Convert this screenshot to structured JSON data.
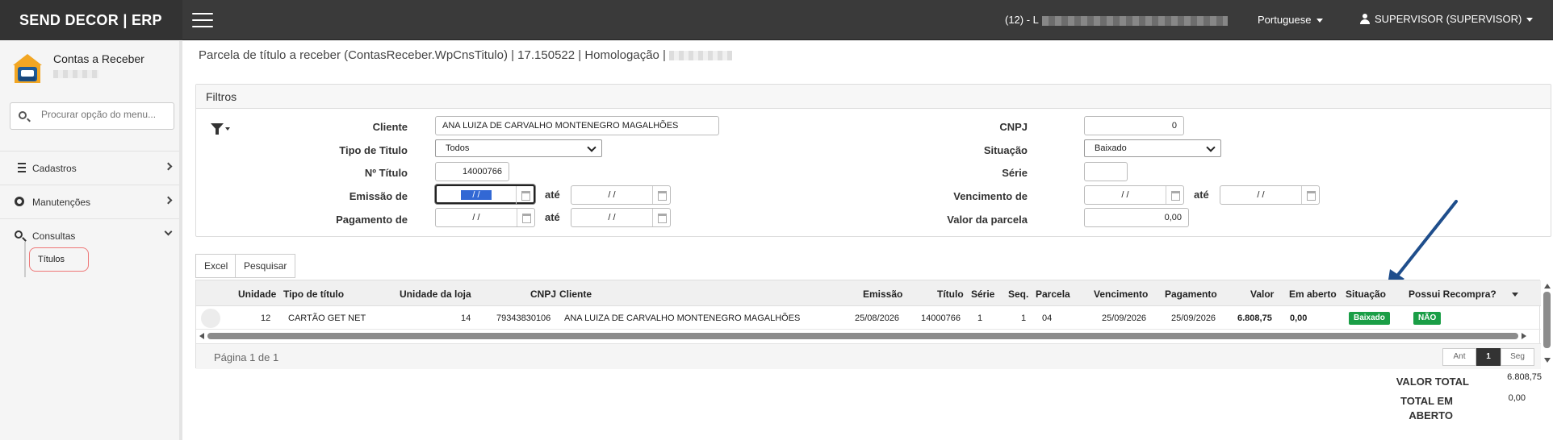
{
  "topbar": {
    "brand": "SEND DECOR | ERP",
    "company_prefix": "(12) - L",
    "language": "Portuguese",
    "user": "SUPERVISOR (SUPERVISOR)"
  },
  "sidebar": {
    "module_title": "Contas a Receber",
    "search_placeholder": "Procurar opção do menu...",
    "items": [
      {
        "label": "Cadastros"
      },
      {
        "label": "Manutenções"
      },
      {
        "label": "Consultas"
      }
    ],
    "sub_item": "Títulos"
  },
  "breadcrumb": "Parcela de título a receber (ContasReceber.WpCnsTitulo) | 17.150522 | Homologação |",
  "filters": {
    "title": "Filtros",
    "cliente_label": "Cliente",
    "cliente_value": "ANA LUIZA DE CARVALHO MONTENEGRO MAGALHÕES",
    "tipo_label": "Tipo de Titulo",
    "tipo_value": "Todos",
    "numero_label": "Nº Título",
    "numero_value": "14000766",
    "emissao_label": "Emissão de",
    "pagamento_label": "Pagamento de",
    "ate_label": "até",
    "date_empty": "/ /",
    "cnpj_label": "CNPJ",
    "cnpj_value": "0",
    "situacao_label": "Situação",
    "situacao_value": "Baixado",
    "serie_label": "Série",
    "vencimento_label": "Vencimento de",
    "valor_parcela_label": "Valor da parcela",
    "valor_parcela_value": "0,00"
  },
  "toolbar": {
    "excel": "Excel",
    "pesquisar": "Pesquisar"
  },
  "grid": {
    "headers": [
      "Unidade",
      "Tipo de título",
      "Unidade da loja",
      "CNPJ",
      "Cliente",
      "Emissão",
      "Título",
      "Série",
      "Seq.",
      "Parcela",
      "Vencimento",
      "Pagamento",
      "Valor",
      "Em aberto",
      "Situação",
      "Possui Recompra?"
    ],
    "row": {
      "unidade": "12",
      "tipo": "CARTÃO GET NET",
      "unidade_loja": "14",
      "cnpj": "79343830106",
      "cliente": "ANA LUIZA DE CARVALHO MONTENEGRO MAGALHÕES",
      "emissao": "25/08/2026",
      "titulo": "14000766",
      "serie": "1",
      "seq": "1",
      "parcela": "04",
      "vencimento": "25/09/2026",
      "pagamento": "25/09/2026",
      "valor": "6.808,75",
      "em_aberto": "0,00",
      "situacao": "Baixado",
      "recompra": "NÃO"
    },
    "page_info": "Página 1 de 1",
    "pager_prev": "Ant",
    "pager_current": "1",
    "pager_next": "Seg"
  },
  "totals": {
    "valor_total_label": "VALOR TOTAL",
    "valor_total": "6.808,75",
    "total_aberto_label_1": "TOTAL EM",
    "total_aberto_label_2": "ABERTO",
    "total_aberto": "0,00"
  },
  "colors": {
    "topbar": "#3a3a3a",
    "badge_green": "#1a9e46",
    "arrow_blue": "#1f4e8c",
    "highlight_red": "#e77777"
  },
  "icons": [
    "hamburger-icon",
    "user-icon",
    "app-logo-icon",
    "search-icon",
    "list-icon",
    "gear-icon",
    "magnifier-icon",
    "chevron-right-icon",
    "chevron-down-icon",
    "filter-icon",
    "calendar-icon",
    "sort-caret-icon",
    "annotation-arrow"
  ]
}
